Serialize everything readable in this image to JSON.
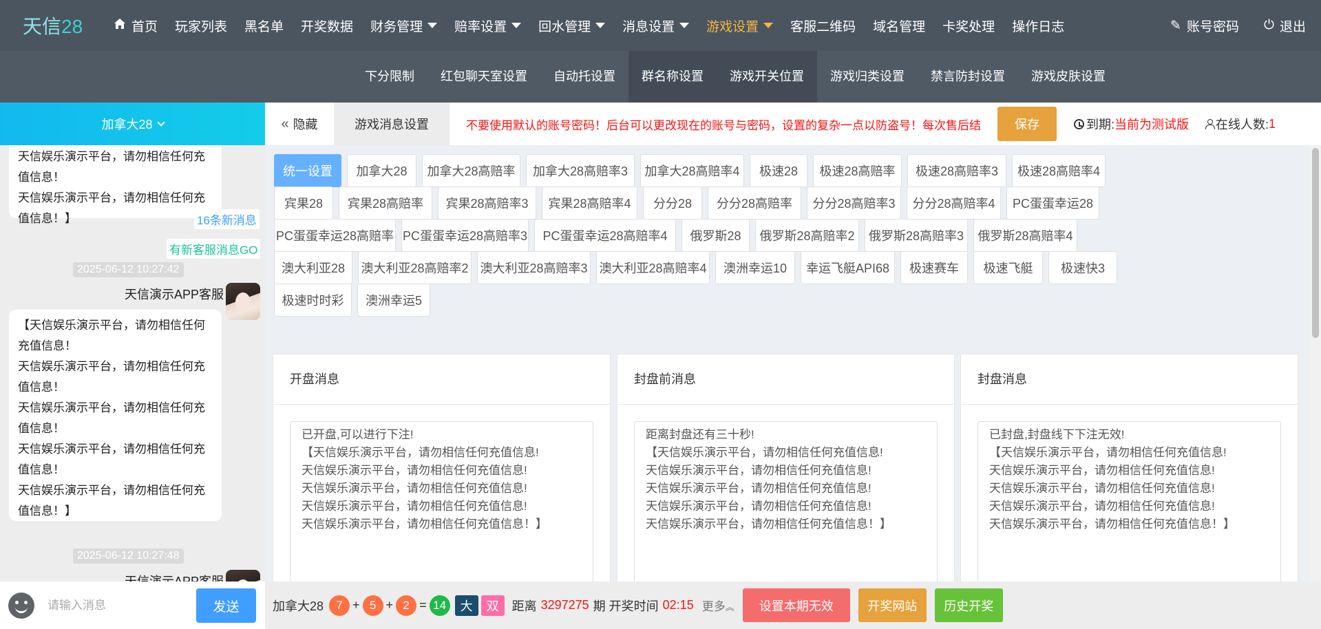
{
  "app": {
    "logo_text": "天信",
    "logo_num": "28"
  },
  "nav": {
    "items": [
      {
        "label": "首页",
        "icon": "home-icon"
      },
      {
        "label": "玩家列表"
      },
      {
        "label": "黑名单"
      },
      {
        "label": "开奖数据"
      },
      {
        "label": "财务管理",
        "dropdown": true
      },
      {
        "label": "赔率设置",
        "dropdown": true
      },
      {
        "label": "回水管理",
        "dropdown": true
      },
      {
        "label": "消息设置",
        "dropdown": true
      },
      {
        "label": "游戏设置",
        "dropdown": true,
        "active": true
      },
      {
        "label": "客服二维码"
      },
      {
        "label": "域名管理"
      },
      {
        "label": "卡奖处理"
      },
      {
        "label": "操作日志"
      }
    ],
    "account": "账号密码",
    "logout": "退出",
    "active_color": "#f5b83d"
  },
  "subnav": {
    "items": [
      "下分限制",
      "红包聊天室设置",
      "自动托设置",
      "群名称设置",
      "游戏开关位置",
      "游戏归类设置",
      "禁言防封设置",
      "游戏皮肤设置"
    ]
  },
  "left": {
    "game_select": "加拿大28",
    "badge_new": "16条新消息",
    "badge_service": "有新客服消息GO",
    "messages": [
      {
        "text": "天信娱乐演示平台，请勿相信任何充值信息！\n天信娱乐演示平台，请勿相信任何充值信息！】"
      },
      {
        "time": "2025-06-12 10:27:42",
        "sender": "天信演示APP客服",
        "text": "【天信娱乐演示平台，请勿相信任何充值信息！\n天信娱乐演示平台，请勿相信任何充值信息！\n天信娱乐演示平台，请勿相信任何充值信息！\n天信娱乐演示平台，请勿相信任何充值信息！\n天信娱乐演示平台，请勿相信任何充值信息！】"
      },
      {
        "time": "2025-06-12 10:27:48",
        "sender": "天信演示APP客服"
      }
    ],
    "input_placeholder": "请输入消息",
    "send": "发送"
  },
  "top": {
    "hide": "隐藏",
    "tab": "游戏消息设置",
    "warning": "不要使用默认的账号密码！后台可以更改现在的账号与密码，设置的复杂一点以防盗号！每次售后结",
    "save": "保存",
    "expire_label": "到期:",
    "expire_value": "当前为测试版",
    "online_label": "在线人数:",
    "online_value": "1"
  },
  "games": [
    "统一设置",
    "加拿大28",
    "加拿大28高赔率",
    "加拿大28高赔率3",
    "加拿大28高赔率4",
    "极速28",
    "极速28高赔率",
    "极速28高赔率3",
    "极速28高赔率4",
    "宾果28",
    "宾果28高赔率",
    "宾果28高赔率3",
    "宾果28高赔率4",
    "分分28",
    "分分28高赔率",
    "分分28高赔率3",
    "分分28高赔率4",
    "PC蛋蛋幸运28",
    "PC蛋蛋幸运28高赔率",
    "PC蛋蛋幸运28高赔率3",
    "PC蛋蛋幸运28高赔率4",
    "俄罗斯28",
    "俄罗斯28高赔率2",
    "俄罗斯28高赔率3",
    "俄罗斯28高赔率4",
    "澳大利亚28",
    "澳大利亚28高赔率2",
    "澳大利亚28高赔率3",
    "澳大利亚28高赔率4",
    "澳洲幸运10",
    "幸运飞艇API68",
    "极速赛车",
    "极速飞艇",
    "极速快3",
    "极速时时彩",
    "澳洲幸运5"
  ],
  "panels": [
    {
      "title": "开盘消息",
      "text": "已开盘,可以进行下注!\n【天信娱乐演示平台，请勿相信任何充值信息!\n天信娱乐演示平台，请勿相信任何充值信息!\n天信娱乐演示平台，请勿相信任何充值信息!\n天信娱乐演示平台，请勿相信任何充值信息!\n天信娱乐演示平台，请勿相信任何充值信息！】"
    },
    {
      "title": "封盘前消息",
      "text": "距离封盘还有三十秒!\n【天信娱乐演示平台，请勿相信任何充值信息!\n天信娱乐演示平台，请勿相信任何充值信息!\n天信娱乐演示平台，请勿相信任何充值信息!\n天信娱乐演示平台，请勿相信任何充值信息!\n天信娱乐演示平台，请勿相信任何充值信息！】"
    },
    {
      "title": "封盘消息",
      "text": "已封盘,封盘线下下注无效!\n【天信娱乐演示平台，请勿相信任何充值信息!\n天信娱乐演示平台，请勿相信任何充值信息!\n天信娱乐演示平台，请勿相信任何充值信息!\n天信娱乐演示平台，请勿相信任何充值信息!\n天信娱乐演示平台，请勿相信任何充值信息！】"
    }
  ],
  "bottom": {
    "game": "加拿大28",
    "n1": "7",
    "n2": "5",
    "n3": "2",
    "sum": "14",
    "size": "大",
    "parity": "双",
    "dist_label": "距离",
    "period": "3297275",
    "period_label": "期 开奖时间",
    "countdown": "02:15",
    "more": "更多",
    "invalid": "设置本期无效",
    "draw_site": "开奖网站",
    "history": "历史开奖",
    "colors": {
      "invalid": "#f56c6c",
      "draw_site": "#e6a23c",
      "history": "#67c23a"
    }
  }
}
